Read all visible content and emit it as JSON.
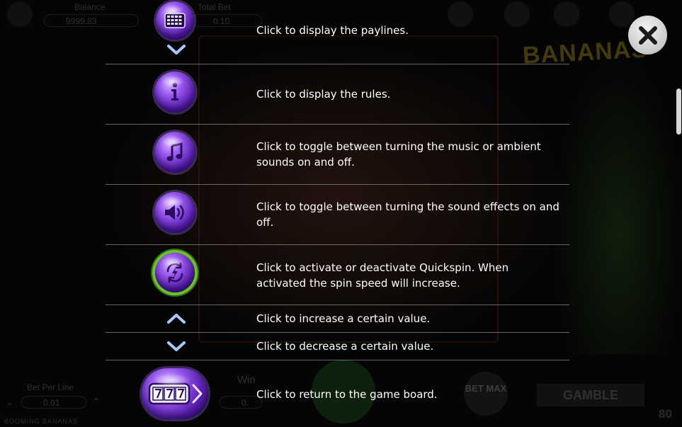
{
  "background": {
    "balance_label": "Balance",
    "balance_value": "9999.83",
    "total_bet_label": "Total Bet",
    "total_bet_value": "0.10",
    "bet_per_line_label": "Bet Per Line",
    "bet_per_line_value": "0.01",
    "win_label": "Win",
    "win_value": "0.",
    "bet_max_label": "BET MAX",
    "gamble_label": "GAMBLE",
    "credit_fragment": "80",
    "footer_title": "BOOMING BANANAS",
    "logo_text": "BANANAS"
  },
  "help_rows": [
    {
      "icon": "paylines-icon",
      "text": "Click to display the paylines."
    },
    {
      "icon": "info-icon",
      "text": "Click to display the rules."
    },
    {
      "icon": "music-note-icon",
      "text": "Click to toggle between turning the music or ambient sounds on and off."
    },
    {
      "icon": "speaker-icon",
      "text": "Click to toggle between turning the sound effects on and off."
    },
    {
      "icon": "quickspin-icon",
      "text": "Click to activate or deactivate Quickspin. When activated the spin speed will increase."
    },
    {
      "icon": "chevron-up-icon",
      "text": "Click to increase a certain value."
    },
    {
      "icon": "chevron-down-icon",
      "text": "Click to decrease a certain value."
    },
    {
      "icon": "slot-machine-icon",
      "text": "Click to return to the game board."
    }
  ],
  "close_icon": "close-icon",
  "colors": {
    "orb_purple": "#6a2bc4",
    "quickspin_ring": "#6cbf2e",
    "chevron": "#a9c8ff",
    "separator": "#8a8a8a"
  }
}
